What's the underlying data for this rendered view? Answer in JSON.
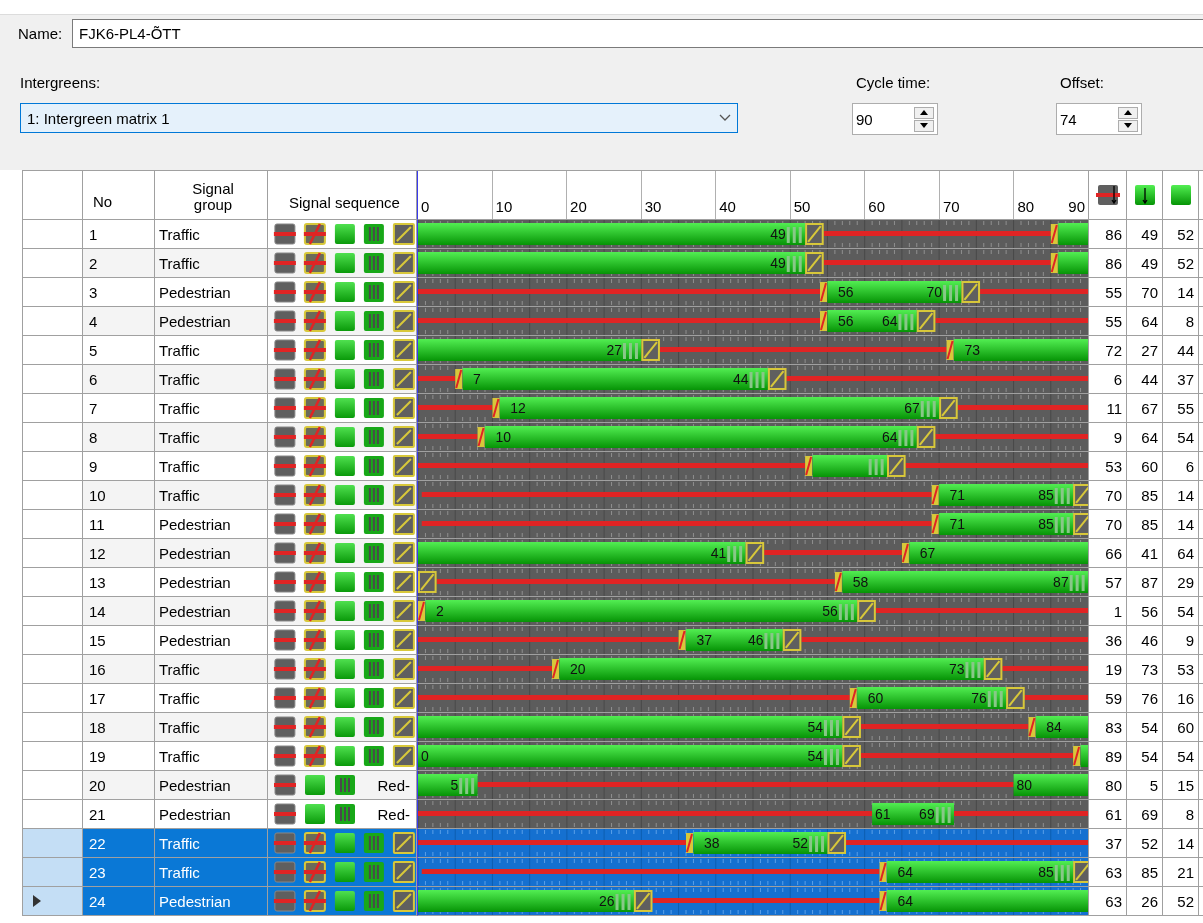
{
  "name": {
    "label": "Name:",
    "value": "FJK6-PL4-ÕTT"
  },
  "intergreens": {
    "label": "Intergreens:",
    "value": "1: Intergreen matrix 1"
  },
  "cycle_time": {
    "label": "Cycle time:",
    "value": "90"
  },
  "offset": {
    "label": "Offset:",
    "value": "74"
  },
  "table": {
    "columns": [
      "No",
      "Signal group",
      "Signal sequence"
    ],
    "timeline_ticks": [
      "0",
      "10",
      "20",
      "30",
      "40",
      "50",
      "60",
      "70",
      "80",
      "90"
    ],
    "rows": [
      {
        "no": "1",
        "group": "Traffic",
        "sequence": {
          "kind": "full"
        },
        "labels": [
          {
            "text": "49",
            "kind": "end"
          }
        ],
        "column_1": "86",
        "column_2": "49",
        "column_3": "52",
        "selected": false,
        "current": false
      },
      {
        "no": "2",
        "group": "Traffic",
        "sequence": {
          "kind": "full"
        },
        "labels": [
          {
            "text": "49",
            "kind": "end"
          }
        ],
        "column_1": "86",
        "column_2": "49",
        "column_3": "52",
        "selected": false,
        "current": false
      },
      {
        "no": "3",
        "group": "Pedestrian",
        "sequence": {
          "kind": "full"
        },
        "labels": [
          {
            "text": "56",
            "kind": "start"
          },
          {
            "text": "70",
            "kind": "end"
          }
        ],
        "column_1": "55",
        "column_2": "70",
        "column_3": "14",
        "selected": false,
        "current": false
      },
      {
        "no": "4",
        "group": "Pedestrian",
        "sequence": {
          "kind": "full"
        },
        "labels": [
          {
            "text": "56",
            "kind": "start"
          },
          {
            "text": "64",
            "kind": "end"
          }
        ],
        "column_1": "55",
        "column_2": "64",
        "column_3": "8",
        "selected": false,
        "current": false
      },
      {
        "no": "5",
        "group": "Traffic",
        "sequence": {
          "kind": "full"
        },
        "labels": [
          {
            "text": "27",
            "kind": "end"
          },
          {
            "text": "73",
            "kind": "start"
          }
        ],
        "column_1": "72",
        "column_2": "27",
        "column_3": "44",
        "selected": false,
        "current": false
      },
      {
        "no": "6",
        "group": "Traffic",
        "sequence": {
          "kind": "full"
        },
        "labels": [
          {
            "text": "7",
            "kind": "start"
          },
          {
            "text": "44",
            "kind": "end"
          }
        ],
        "column_1": "6",
        "column_2": "44",
        "column_3": "37",
        "selected": false,
        "current": false
      },
      {
        "no": "7",
        "group": "Traffic",
        "sequence": {
          "kind": "full"
        },
        "labels": [
          {
            "text": "12",
            "kind": "start"
          },
          {
            "text": "67",
            "kind": "end"
          }
        ],
        "column_1": "11",
        "column_2": "67",
        "column_3": "55",
        "selected": false,
        "current": false
      },
      {
        "no": "8",
        "group": "Traffic",
        "sequence": {
          "kind": "full"
        },
        "labels": [
          {
            "text": "10",
            "kind": "start"
          },
          {
            "text": "64",
            "kind": "end"
          }
        ],
        "column_1": "9",
        "column_2": "64",
        "column_3": "54",
        "selected": false,
        "current": false
      },
      {
        "no": "9",
        "group": "Traffic",
        "sequence": {
          "kind": "full"
        },
        "labels": [],
        "column_1": "53",
        "column_2": "60",
        "column_3": "6",
        "selected": false,
        "current": false
      },
      {
        "no": "10",
        "group": "Traffic",
        "sequence": {
          "kind": "full"
        },
        "labels": [
          {
            "text": "71",
            "kind": "start"
          },
          {
            "text": "85",
            "kind": "end"
          }
        ],
        "column_1": "70",
        "column_2": "85",
        "column_3": "14",
        "selected": false,
        "current": false
      },
      {
        "no": "11",
        "group": "Pedestrian",
        "sequence": {
          "kind": "full"
        },
        "labels": [
          {
            "text": "71",
            "kind": "start"
          },
          {
            "text": "85",
            "kind": "end"
          }
        ],
        "column_1": "70",
        "column_2": "85",
        "column_3": "14",
        "selected": false,
        "current": false
      },
      {
        "no": "12",
        "group": "Pedestrian",
        "sequence": {
          "kind": "full"
        },
        "labels": [
          {
            "text": "41",
            "kind": "end"
          },
          {
            "text": "67",
            "kind": "start"
          }
        ],
        "column_1": "66",
        "column_2": "41",
        "column_3": "64",
        "selected": false,
        "current": false
      },
      {
        "no": "13",
        "group": "Pedestrian",
        "sequence": {
          "kind": "full"
        },
        "labels": [
          {
            "text": "58",
            "kind": "start"
          },
          {
            "text": "87",
            "kind": "end"
          }
        ],
        "column_1": "57",
        "column_2": "87",
        "column_3": "29",
        "selected": false,
        "current": false
      },
      {
        "no": "14",
        "group": "Pedestrian",
        "sequence": {
          "kind": "full"
        },
        "labels": [
          {
            "text": "2",
            "kind": "start"
          },
          {
            "text": "56",
            "kind": "end"
          }
        ],
        "column_1": "1",
        "column_2": "56",
        "column_3": "54",
        "selected": false,
        "current": false
      },
      {
        "no": "15",
        "group": "Pedestrian",
        "sequence": {
          "kind": "full"
        },
        "labels": [
          {
            "text": "37",
            "kind": "start"
          },
          {
            "text": "46",
            "kind": "end"
          }
        ],
        "column_1": "36",
        "column_2": "46",
        "column_3": "9",
        "selected": false,
        "current": false
      },
      {
        "no": "16",
        "group": "Traffic",
        "sequence": {
          "kind": "full"
        },
        "labels": [
          {
            "text": "20",
            "kind": "start"
          },
          {
            "text": "73",
            "kind": "end"
          }
        ],
        "column_1": "19",
        "column_2": "73",
        "column_3": "53",
        "selected": false,
        "current": false
      },
      {
        "no": "17",
        "group": "Traffic",
        "sequence": {
          "kind": "full"
        },
        "labels": [
          {
            "text": "60",
            "kind": "start"
          },
          {
            "text": "76",
            "kind": "end"
          }
        ],
        "column_1": "59",
        "column_2": "76",
        "column_3": "16",
        "selected": false,
        "current": false
      },
      {
        "no": "18",
        "group": "Traffic",
        "sequence": {
          "kind": "full"
        },
        "labels": [
          {
            "text": "54",
            "kind": "end"
          },
          {
            "text": "84",
            "kind": "start"
          }
        ],
        "column_1": "83",
        "column_2": "54",
        "column_3": "60",
        "selected": false,
        "current": false
      },
      {
        "no": "19",
        "group": "Traffic",
        "sequence": {
          "kind": "full"
        },
        "labels": [
          {
            "text": "0",
            "kind": "start"
          },
          {
            "text": "54",
            "kind": "end"
          }
        ],
        "column_1": "89",
        "column_2": "54",
        "column_3": "54",
        "selected": false,
        "current": false
      },
      {
        "no": "20",
        "group": "Pedestrian",
        "sequence": {
          "kind": "short",
          "note": "Red-"
        },
        "labels": [
          {
            "text": "5",
            "kind": "end"
          },
          {
            "text": "80",
            "kind": "start"
          }
        ],
        "column_1": "80",
        "column_2": "5",
        "column_3": "15",
        "selected": false,
        "current": false
      },
      {
        "no": "21",
        "group": "Pedestrian",
        "sequence": {
          "kind": "short",
          "note": "Red-"
        },
        "labels": [
          {
            "text": "61",
            "kind": "start"
          },
          {
            "text": "69",
            "kind": "end"
          }
        ],
        "column_1": "61",
        "column_2": "69",
        "column_3": "8",
        "selected": false,
        "current": false
      },
      {
        "no": "22",
        "group": "Traffic",
        "sequence": {
          "kind": "full"
        },
        "labels": [
          {
            "text": "38",
            "kind": "start"
          },
          {
            "text": "52",
            "kind": "end"
          }
        ],
        "column_1": "37",
        "column_2": "52",
        "column_3": "14",
        "selected": true,
        "current": false
      },
      {
        "no": "23",
        "group": "Traffic",
        "sequence": {
          "kind": "full"
        },
        "labels": [
          {
            "text": "64",
            "kind": "start"
          },
          {
            "text": "85",
            "kind": "end"
          }
        ],
        "column_1": "63",
        "column_2": "85",
        "column_3": "21",
        "selected": true,
        "current": false
      },
      {
        "no": "24",
        "group": "Pedestrian",
        "sequence": {
          "kind": "full"
        },
        "labels": [
          {
            "text": "26",
            "kind": "end"
          },
          {
            "text": "64",
            "kind": "start"
          }
        ],
        "column_1": "63",
        "column_2": "26",
        "column_3": "52",
        "selected": true,
        "current": true
      }
    ]
  }
}
